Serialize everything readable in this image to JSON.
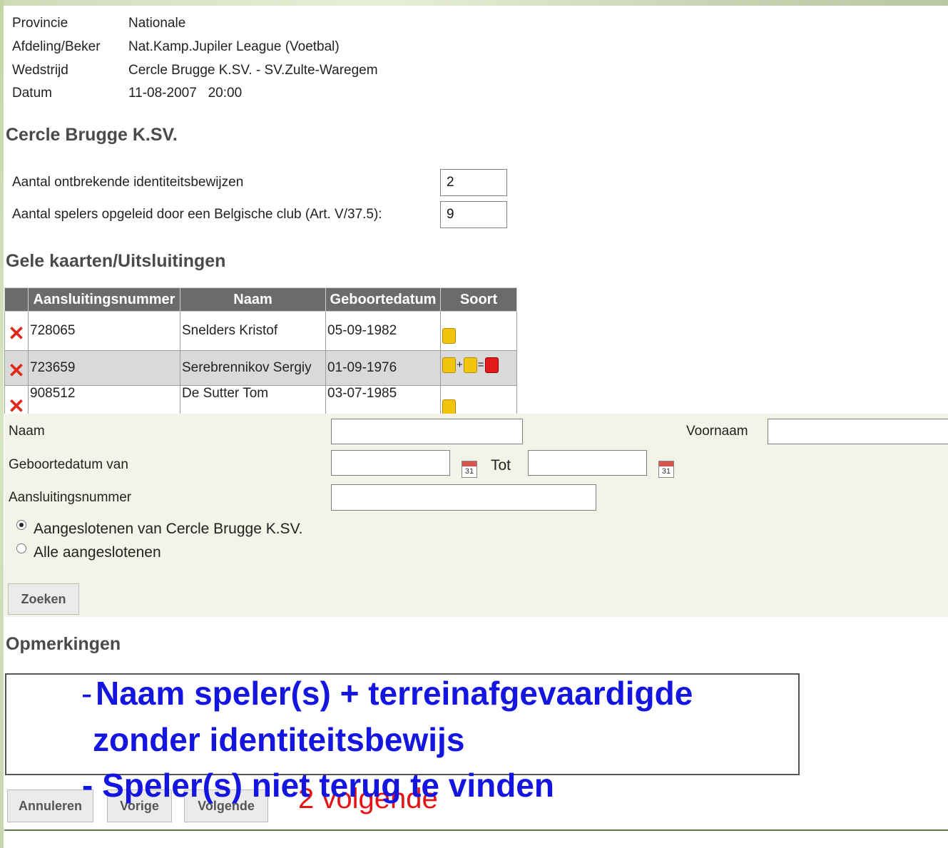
{
  "info": {
    "provincie_label": "Provincie",
    "provincie_value": "Nationale",
    "afdeling_label": "Afdeling/Beker",
    "afdeling_value": "Nat.Kamp.Jupiler League (Voetbal)",
    "wedstrijd_label": "Wedstrijd",
    "wedstrijd_value": "Cercle Brugge K.SV. - SV.Zulte-Waregem",
    "datum_label": "Datum",
    "datum_value": "11-08-2007   20:00"
  },
  "team_heading": "Cercle Brugge K.SV.",
  "counts": {
    "missing_ids_label": "Aantal ontbrekende identiteitsbewijzen",
    "missing_ids_value": "2",
    "trained_label": "Aantal spelers opgeleid door een Belgische club (Art. V/37.5):",
    "trained_value": "9"
  },
  "cards_heading": "Gele kaarten/Uitsluitingen",
  "cards_table": {
    "headers": [
      "Aansluitingsnummer",
      "Naam",
      "Geboortedatum",
      "Soort"
    ],
    "rows": [
      {
        "nummer": "728065",
        "naam": "Snelders Kristof",
        "geboortedatum": "05-09-1982",
        "soort": "yellow"
      },
      {
        "nummer": "723659",
        "naam": "Serebrennikov Sergiy",
        "geboortedatum": "01-09-1976",
        "soort": "yellow+yellow=red",
        "op_plus": "+",
        "op_eq": "="
      },
      {
        "nummer": "908512",
        "naam": "De Sutter Tom",
        "geboortedatum": "03-07-1985",
        "soort": "yellow"
      }
    ]
  },
  "search": {
    "naam_label": "Naam",
    "voornaam_label": "Voornaam",
    "geboortedatum_van_label": "Geboortedatum van",
    "tot_label": "Tot",
    "calendar_day": "31",
    "aansluitingsnummer_label": "Aansluitingsnummer",
    "radio_club_label": "Aangeslotenen van Cercle Brugge K.SV.",
    "radio_all_label": "Alle aangeslotenen",
    "selected_radio": "club",
    "zoeken_label": "Zoeken"
  },
  "remarks_heading": "Opmerkingen",
  "buttons": {
    "annuleren": "Annuleren",
    "vorige": "Vorige",
    "volgende": "Volgende"
  },
  "annotations": {
    "line1_dash": "-",
    "line1": "Naam speler(s) + terreinafgevaardigde",
    "line2": "zonder identiteitsbewijs",
    "line3": "- Speler(s) niet terug te vinden",
    "red_note": "2 volgende"
  },
  "colors": {
    "header_bg": "#6b6b6b",
    "annotation_blue": "#1515e0",
    "annotation_red": "#e41414",
    "search_panel_bg": "#f3f3e7"
  }
}
